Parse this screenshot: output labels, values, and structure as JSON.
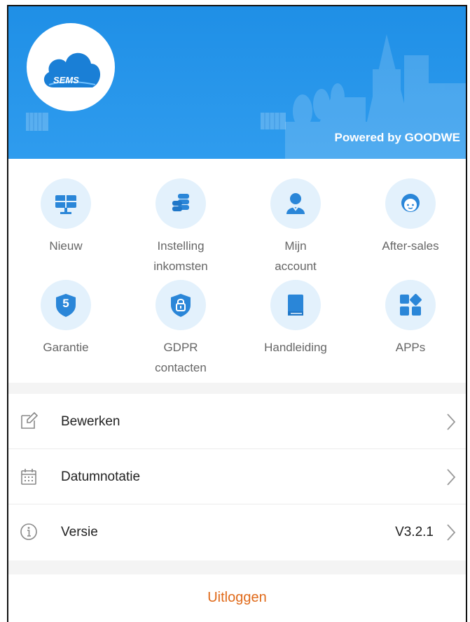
{
  "header": {
    "logo_text": "SEMS",
    "powered_by": "Powered by GOODWE",
    "bg_color": "#2a96ea"
  },
  "grid": [
    {
      "label": "Nieuw",
      "icon": "solar-panel-icon"
    },
    {
      "label": "Instelling\ninkomsten",
      "icon": "coins-icon"
    },
    {
      "label": "Mijn\naccount",
      "icon": "user-icon"
    },
    {
      "label": "After-sales",
      "icon": "support-agent-icon"
    },
    {
      "label": "Garantie",
      "icon": "warranty-shield-icon",
      "badge": "5"
    },
    {
      "label": "GDPR\ncontacten",
      "icon": "lock-shield-icon"
    },
    {
      "label": "Handleiding",
      "icon": "book-icon"
    },
    {
      "label": "APPs",
      "icon": "apps-grid-icon"
    }
  ],
  "list": [
    {
      "label": "Bewerken",
      "icon": "edit-icon",
      "value": ""
    },
    {
      "label": "Datumnotatie",
      "icon": "calendar-icon",
      "value": ""
    },
    {
      "label": "Versie",
      "icon": "info-icon",
      "value": "V3.2.1"
    }
  ],
  "logout_label": "Uitloggen",
  "colors": {
    "accent": "#2a96ea",
    "logout": "#e06a1a",
    "icon_bg": "#e3f1fc"
  }
}
